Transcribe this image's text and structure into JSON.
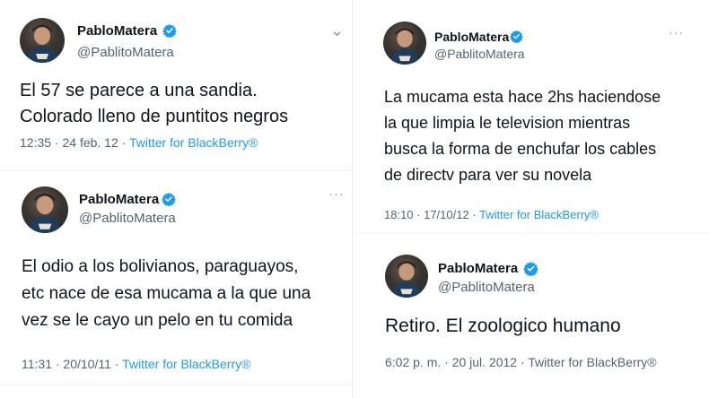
{
  "accent_color": "#1d9bf0",
  "tweets": [
    {
      "name": "PabloMatera",
      "handle": "@PablitoMatera",
      "menu_icon": "chevron-down-icon",
      "menu_glyph": "⌄",
      "lines": [
        "El 57 se parece a una sandia.",
        "Colorado lleno de puntitos negros"
      ],
      "time": "12:35 · 24 feb. 12 · ",
      "source": "Twitter for BlackBerry®"
    },
    {
      "name": "PabloMatera",
      "handle": "@PablitoMatera",
      "menu_icon": "more-icon",
      "menu_glyph": "···",
      "lines": [
        "El odio a los bolivianos, paraguayos,",
        "etc nace de esa mucama a la que una",
        "vez se le cayo un pelo en tu comida"
      ],
      "time": "11:31 · 20/10/11 · ",
      "source": "Twitter for BlackBerry®"
    },
    {
      "name": "PabloMatera",
      "handle": "@PablitoMatera",
      "menu_icon": "more-icon",
      "menu_glyph": "···",
      "lines": [
        "La mucama esta hace 2hs haciendose",
        "la que limpia le television mientras",
        "busca la forma de enchufar los cables",
        "de directv para ver su novela"
      ],
      "time": "18:10 · 17/10/12 · ",
      "source": "Twitter for BlackBerry®"
    },
    {
      "name": "PabloMatera",
      "handle": "@PablitoMatera",
      "menu_icon": "more-icon",
      "menu_glyph": "",
      "lines": [
        "Retiro. El zoologico humano"
      ],
      "time": "6:02 p. m. · 20 jul. 2012 · Twitter for BlackBerry®",
      "source": ""
    }
  ]
}
